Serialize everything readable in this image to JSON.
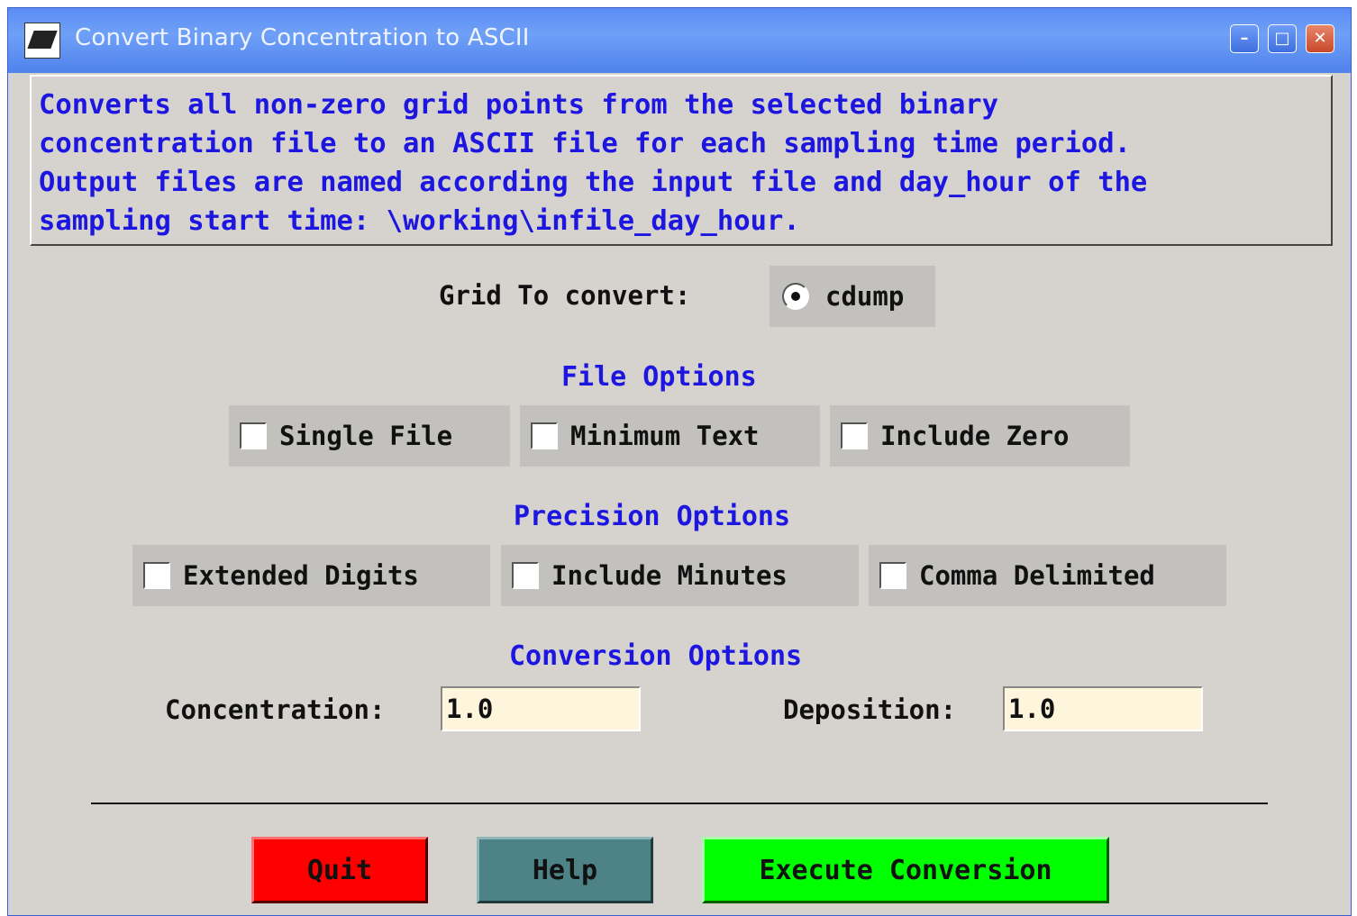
{
  "window": {
    "title": "Convert Binary Concentration to ASCII",
    "controls": {
      "minimize": "–",
      "maximize": "□",
      "close": "✕"
    }
  },
  "description": "Converts all non-zero grid points from the selected binary\nconcentration file to an ASCII file for each sampling time period.\nOutput files are named according the input file and day_hour of the\nsampling start time: \\working\\infile_day_hour.",
  "grid": {
    "label": "Grid To convert:",
    "option": "cdump",
    "selected": true
  },
  "file_options": {
    "heading": "File Options",
    "items": [
      {
        "label": "Single File",
        "checked": false
      },
      {
        "label": "Minimum Text",
        "checked": false
      },
      {
        "label": "Include Zero",
        "checked": false
      }
    ]
  },
  "precision_options": {
    "heading": "Precision Options",
    "items": [
      {
        "label": "Extended Digits",
        "checked": false
      },
      {
        "label": "Include Minutes",
        "checked": false
      },
      {
        "label": "Comma Delimited",
        "checked": false
      }
    ]
  },
  "conversion_options": {
    "heading": "Conversion Options",
    "concentration_label": "Concentration:",
    "concentration_value": "1.0",
    "deposition_label": "Deposition:",
    "deposition_value": "1.0"
  },
  "buttons": {
    "quit": "Quit",
    "help": "Help",
    "execute": "Execute Conversion"
  },
  "colors": {
    "heading_blue": "#1c16e0",
    "quit": "#ff0000",
    "help": "#4d8286",
    "execute": "#00ff00",
    "field_bg": "#fdf6dc"
  }
}
